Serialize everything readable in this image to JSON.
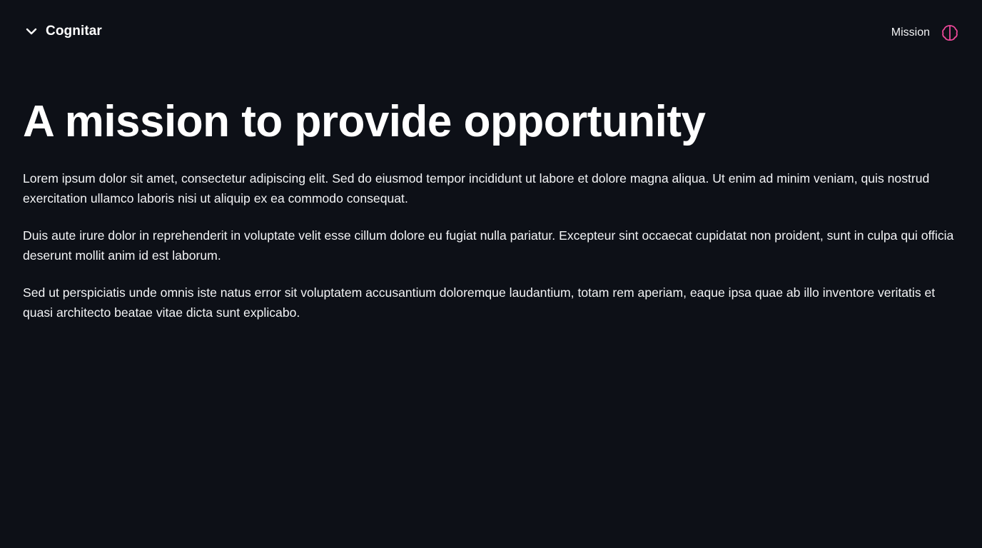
{
  "header": {
    "brand_name": "Cognitar",
    "nav": [
      {
        "label": "Mission"
      }
    ],
    "icons": {
      "toggle": "chevron-down-icon",
      "logo": "brain-icon"
    },
    "accent_color": "#ec4899"
  },
  "main": {
    "title": "A mission to provide opportunity",
    "paragraphs": [
      "Lorem ipsum dolor sit amet, consectetur adipiscing elit. Sed do eiusmod tempor incididunt ut labore et dolore magna aliqua. Ut enim ad minim veniam, quis nostrud exercitation ullamco laboris nisi ut aliquip ex ea commodo consequat.",
      "Duis aute irure dolor in reprehenderit in voluptate velit esse cillum dolore eu fugiat nulla pariatur. Excepteur sint occaecat cupidatat non proident, sunt in culpa qui officia deserunt mollit anim id est laborum.",
      "Sed ut perspiciatis unde omnis iste natus error sit voluptatem accusantium doloremque laudantium, totam rem aperiam, eaque ipsa quae ab illo inventore veritatis et quasi architecto beatae vitae dicta sunt explicabo."
    ]
  }
}
